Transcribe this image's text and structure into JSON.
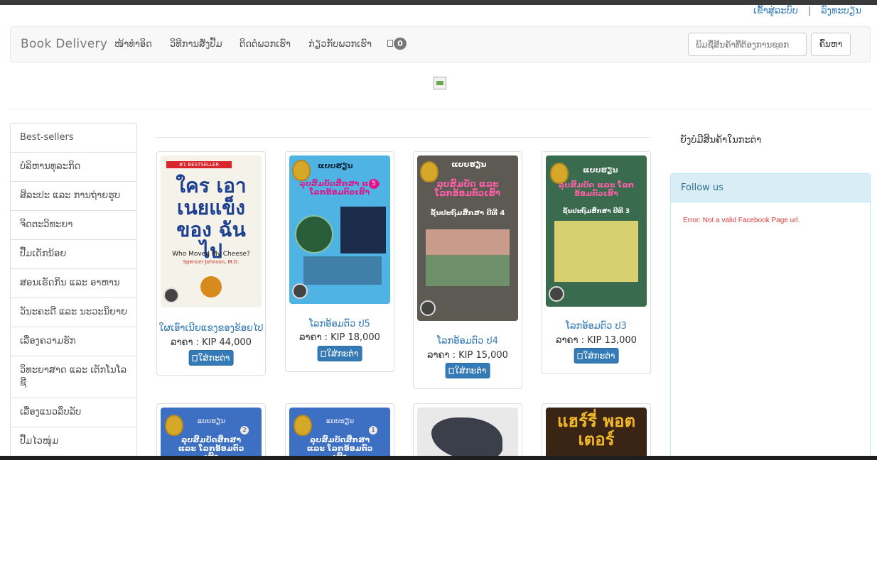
{
  "top_links": {
    "login": "ເຂົ້າສູ່ລະບົບ",
    "separator": "|",
    "register": "ລົງທະບຽນ"
  },
  "navbar": {
    "brand": "Book Delivery",
    "links": [
      "ໜ້າທໍາອິດ",
      "ວິທີການສັ່ງປື້ມ",
      "ຕິດຕໍ່ພວກເຮົາ",
      "ກ່ຽວກັບພວກເຮົາ"
    ],
    "cart_count": "0",
    "search_placeholder": "ພິມຊື່ສິນຄ້າທີ່ຕ້ອງການຊອກ",
    "search_button": "ຄົ້ນຫາ"
  },
  "sidebar": {
    "items": [
      "Best-sellers",
      "ບໍລິຫານທຸລະກິດ",
      "ສິລະປະ ແລະ ການຖ່າຍຮູບ",
      "ຈິດຕະວິທະຍາ",
      "ປື້ມເດັກນ້ອຍ",
      "ສອນເຮັດກິນ ແລະ ອາຫານ",
      "ວັນະຄະດີ ແລະ ນະວະນິຍາຍ",
      "ເລື່ອງຄວາມຮັກ",
      "ວິທະຍາສາດ ແລະ ເຕັກໂນໂລຊີ",
      "ເລື່ອງແນວລຶບລັບ",
      "ປື້ມໄວໜຸ່ມ"
    ]
  },
  "products": [
    {
      "name": "ໃຜເອົາເນີຍແຂງຂອງຂ້ອຍໄປ",
      "price": "ລາຄາ : KIP 44,000",
      "cta": "ໃສ່ກະຕ່າ",
      "cover": {
        "badge": "#1 BESTSELLER",
        "title": "ใคร เอาเนยแข็ง ของ ฉันไป",
        "subtitle": "Who Moved My Cheese?",
        "author": "Spencer Johnson, M.D."
      }
    },
    {
      "name": "ໂລກອ້ອມຕົວ ປ5",
      "price": "ລາຄາ : KIP 18,000",
      "cta": "ໃສ່ກະຕ່າ",
      "cover": {
        "header": "ແບບຮຽນ",
        "title": "ລຸບສົມບັດສຶກສາ ແລະ ໂລກອ້ອມຕົວເຮົາ",
        "grade": "5"
      }
    },
    {
      "name": "ໂລກອ້ອມຕົວ ປ4",
      "price": "ລາຄາ : KIP 15,000",
      "cta": "ໃສ່ກະຕ່າ",
      "cover": {
        "header": "ແບບຮຽນ",
        "title": "ລຸບສົມບັດ ແລະ ໂລກອ້ອມຕົວເຮົາ",
        "subtitle": "ຊັ້ນປະຖົມສຶກສາ ປີທີ 4"
      }
    },
    {
      "name": "ໂລກອ້ອມຕົວ ປ3",
      "price": "ລາຄາ : KIP 13,000",
      "cta": "ໃສ່ກະຕ່າ",
      "cover": {
        "header": "ແບບຮຽນ",
        "title": "ລຸບສົມບັດ ແລະ ໂລກອ້ອມຕົວເຮົາ",
        "subtitle": "ຊັ້ນປະຖົມສຶກສາ ປີທີ 3"
      }
    },
    {
      "cover": {
        "header": "ແບບຮຽນ",
        "title": "ລຸບສົມບັດສຶກສາ ແລະ ໂລກອ້ອມຕົວເຮົາ",
        "grade": "2"
      }
    },
    {
      "cover": {
        "header": "ແບບຮຽນ",
        "title": "ລຸບສົມບັດສຶກສາ ແລະ ໂລກອ້ອມຕົວເຮົາ",
        "grade": "1"
      }
    },
    {
      "cover": {}
    },
    {
      "cover": {
        "title": "แฮร์รี่ พอตเตอร์"
      }
    }
  ],
  "cart_panel": {
    "empty_text": "ຍັງບໍ່ມີສິນຄ້າໃນກະຕ່າ"
  },
  "follow_panel": {
    "heading": "Follow us",
    "error": "Error: Not a valid Facebook Page url."
  },
  "colors": {
    "link": "#337ab7",
    "button": "#337ab7",
    "panel_info_bg": "#d9edf7",
    "error": "#e03a3a"
  }
}
